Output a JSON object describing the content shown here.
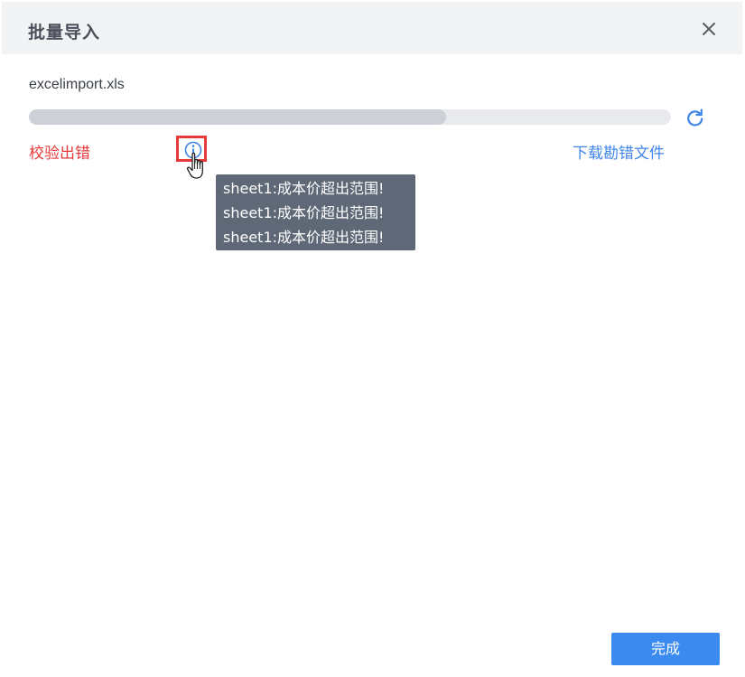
{
  "dialog": {
    "title": "批量导入",
    "close_icon": "close-icon"
  },
  "upload": {
    "filename": "excelimport.xls",
    "progress_fraction": 0.65,
    "refresh_icon": "refresh-icon",
    "status_text": "校验出错",
    "info_icon": "info-circle-icon",
    "download_link": "下载勘错文件"
  },
  "tooltip": {
    "lines": [
      "sheet1:成本价超出范围!",
      "sheet1:成本价超出范围!",
      "sheet1:成本价超出范围!"
    ]
  },
  "footer": {
    "done_label": "完成"
  },
  "colors": {
    "header_bg": "#f2f3f5",
    "error": "#e5393a",
    "link": "#3f86e8",
    "primary_button": "#3b8af0",
    "tooltip_bg": "#5f6877",
    "progress_track": "#e9eaed",
    "progress_fill": "#cdd0d6"
  }
}
